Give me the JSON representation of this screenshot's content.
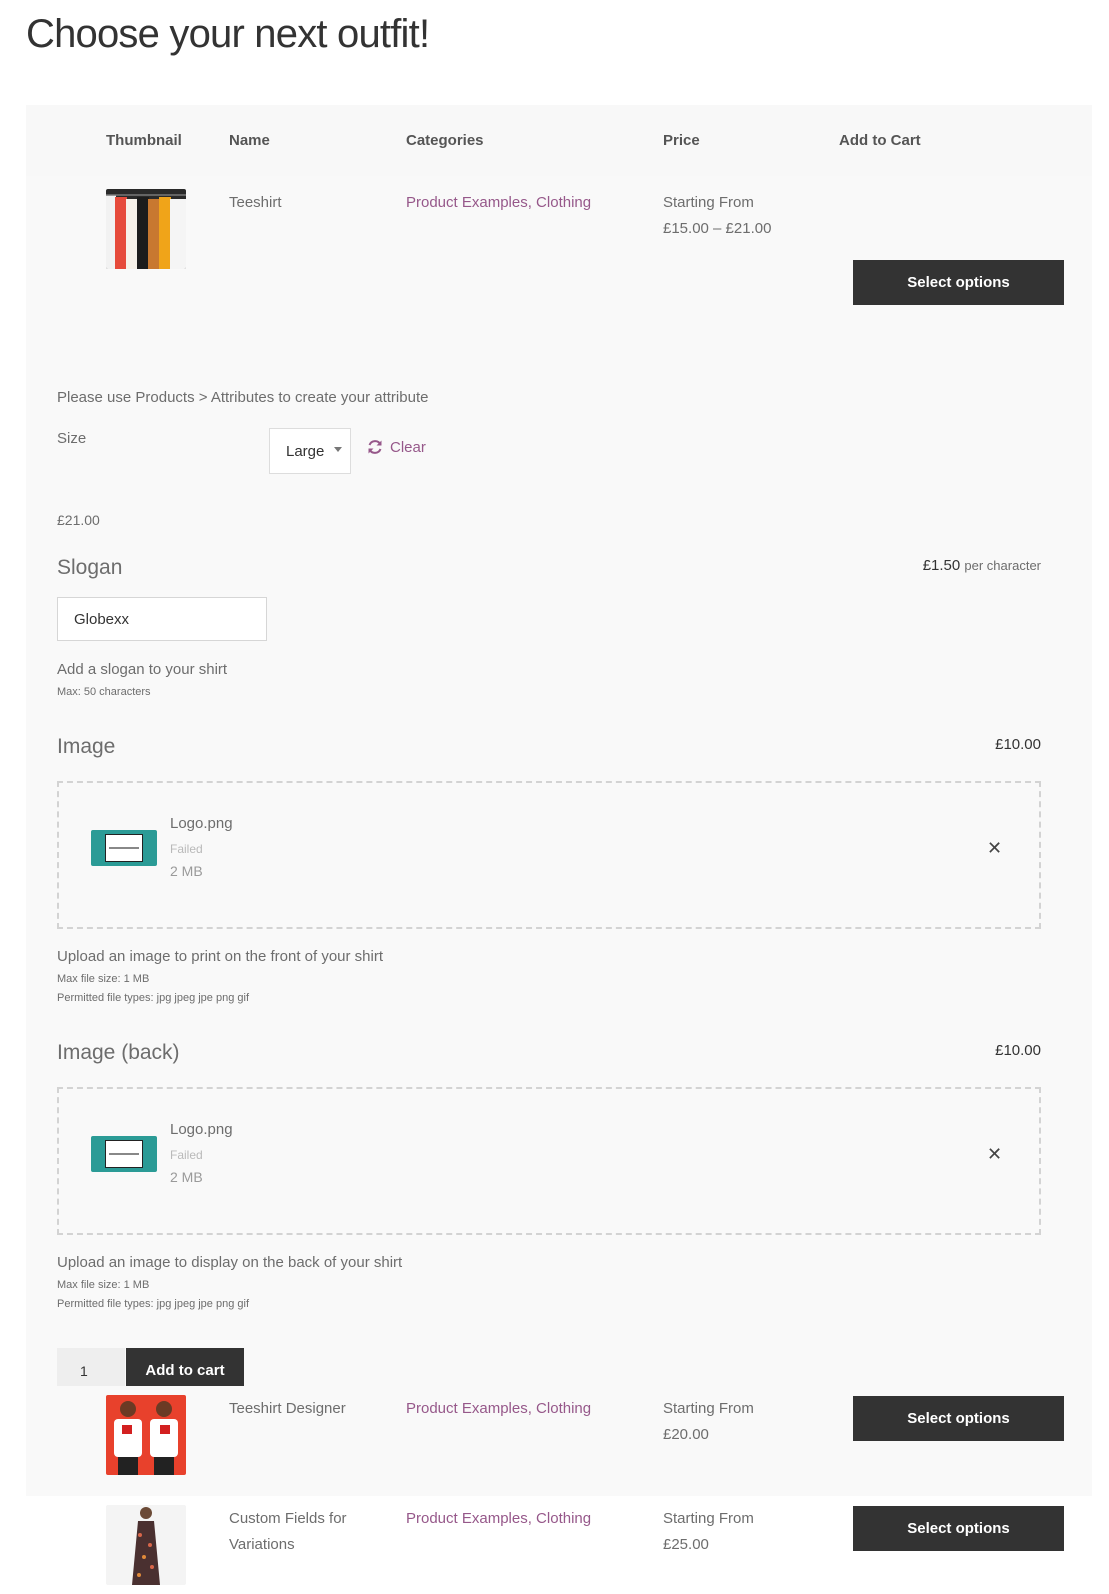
{
  "page": {
    "title": "Choose your next outfit!"
  },
  "table": {
    "headers": [
      "Thumbnail",
      "Name",
      "Categories",
      "Price",
      "Add to Cart"
    ],
    "rows": [
      {
        "name": "Teeshirt",
        "categories": "Product Examples, Clothing",
        "price_label": "Starting From",
        "price_range": "£15.00 – £21.00",
        "button": "Select options"
      },
      {
        "name": "Teeshirt Designer",
        "categories": "Product Examples, Clothing",
        "price_label": "Starting From",
        "price_range": "£20.00",
        "button": "Select options"
      },
      {
        "name_line1": "Custom Fields for",
        "name_line2": "Variations",
        "categories": "Product Examples, Clothing",
        "price_label": "Starting From",
        "price_range": "£25.00",
        "button": "Select options"
      }
    ]
  },
  "variation": {
    "notice": "Please use Products > Attributes to create your attribute",
    "size_label": "Size",
    "size_value": "Large",
    "clear_label": "Clear",
    "selected_price": "£21.00"
  },
  "slogan": {
    "title": "Slogan",
    "price": "£1.50",
    "price_unit": "per character",
    "value": "Globexx",
    "help": "Add a slogan to your shirt",
    "max": "Max: 50 characters"
  },
  "image_front": {
    "title": "Image",
    "price": "£10.00",
    "file_name": "Logo.png",
    "status": "Failed",
    "size": "2 MB",
    "help": "Upload an image to print on the front of your shirt",
    "max_size": "Max file size: 1 MB",
    "types": "Permitted file types: jpg jpeg jpe png gif"
  },
  "image_back": {
    "title": "Image (back)",
    "price": "£10.00",
    "file_name": "Logo.png",
    "status": "Failed",
    "size": "2 MB",
    "help": "Upload an image to display on the back of your shirt",
    "max_size": "Max file size: 1 MB",
    "types": "Permitted file types: jpg jpeg jpe png gif"
  },
  "cart": {
    "quantity": "1",
    "add_label": "Add to cart"
  },
  "colors": {
    "accent": "#96588a",
    "button": "#333333"
  }
}
